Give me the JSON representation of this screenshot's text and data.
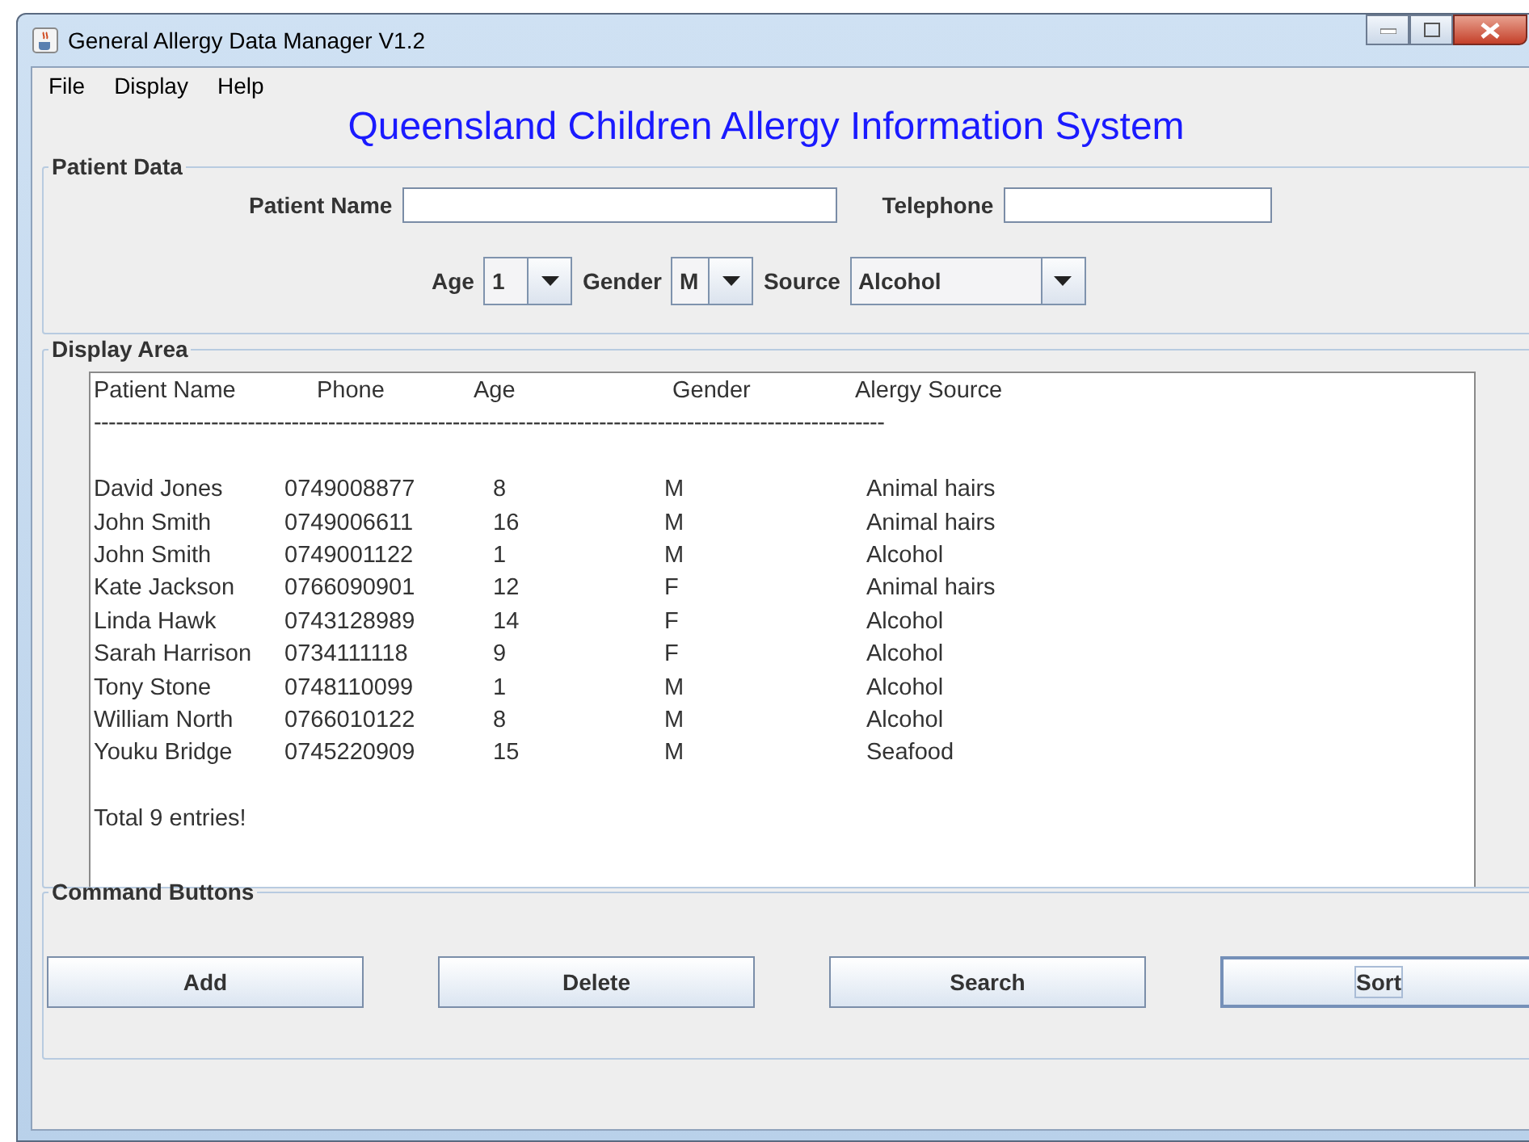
{
  "window": {
    "title": "General Allergy Data Manager V1.2"
  },
  "menu": [
    "File",
    "Display",
    "Help"
  ],
  "heading": "Queensland Children Allergy Information System",
  "patient_data": {
    "title": "Patient Data",
    "name_label": "Patient Name",
    "phone_label": "Telephone",
    "age_label": "Age",
    "age_value": "1",
    "gender_label": "Gender",
    "gender_value": "M",
    "source_label": "Source",
    "source_value": "Alcohol"
  },
  "display_area": {
    "title": "Display Area",
    "header": [
      "Patient Name",
      "Phone",
      "Age",
      "Gender",
      "Alergy Source"
    ],
    "separator": "------------------------------------------------------------------------------------------------------------",
    "rows": [
      [
        "David Jones",
        "0749008877",
        "8",
        "M",
        "Animal hairs"
      ],
      [
        "John Smith",
        "0749006611",
        "16",
        "M",
        "Animal hairs"
      ],
      [
        "John Smith",
        "0749001122",
        "1",
        "M",
        "Alcohol"
      ],
      [
        "Kate Jackson",
        "0766090901",
        "12",
        "F",
        "Animal hairs"
      ],
      [
        "Linda Hawk",
        "0743128989",
        "14",
        "F",
        "Alcohol"
      ],
      [
        "Sarah Harrison",
        "0734111118",
        "9",
        "F",
        "Alcohol"
      ],
      [
        "Tony Stone",
        "0748110099",
        "1",
        "M",
        "Alcohol"
      ],
      [
        "William North",
        "0766010122",
        "8",
        "M",
        "Alcohol"
      ],
      [
        "Youku Bridge",
        "0745220909",
        "15",
        "M",
        "Seafood"
      ]
    ],
    "total": "Total 9 entries!"
  },
  "command_buttons": {
    "title": "Command Buttons",
    "buttons": [
      {
        "label": "Add",
        "focused": false
      },
      {
        "label": "Delete",
        "focused": false
      },
      {
        "label": "Search",
        "focused": false
      },
      {
        "label": "Sort",
        "focused": true
      }
    ]
  }
}
